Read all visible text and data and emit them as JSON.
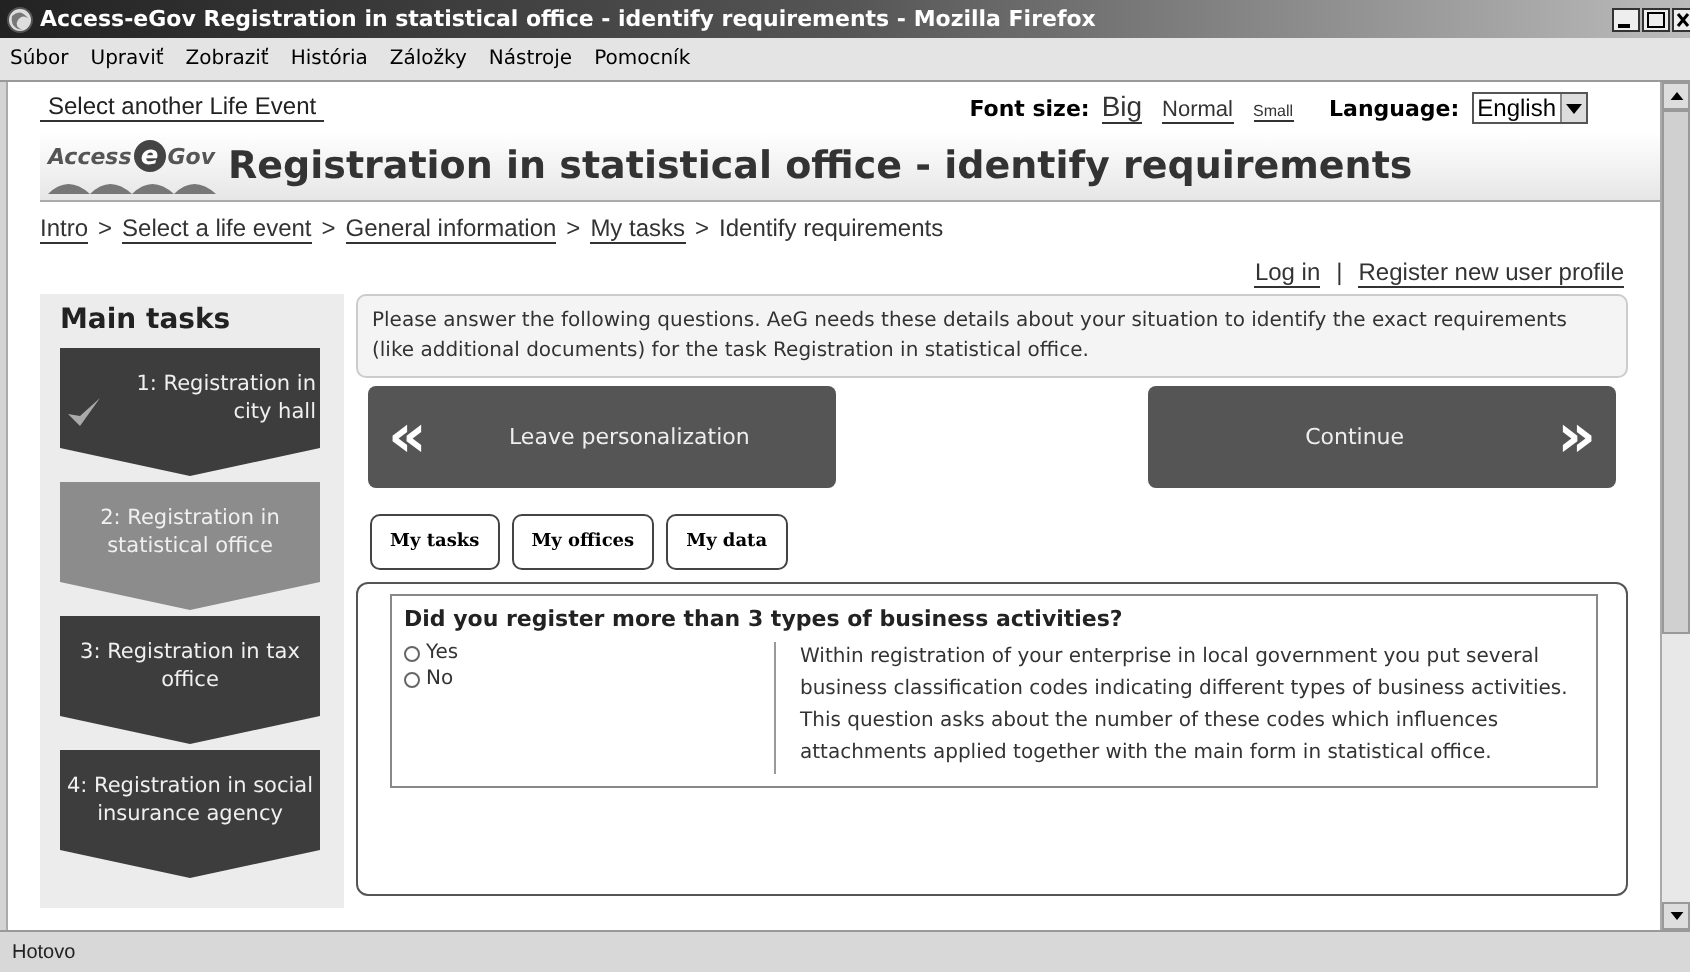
{
  "window": {
    "title": "Access-eGov Registration in statistical office - identify requirements - Mozilla Firefox"
  },
  "menu": [
    "Súbor",
    "Upraviť",
    "Zobraziť",
    "História",
    "Záložky",
    "Nástroje",
    "Pomocník"
  ],
  "top_bar": {
    "life_event_link": "Select another Life Event",
    "font_size_label": "Font size:",
    "font_sizes": [
      "Big",
      "Normal",
      "Small"
    ],
    "language_label": "Language:",
    "language": "English"
  },
  "logo": {
    "left": "Access",
    "mark": "e",
    "right": "Gov"
  },
  "page_title": "Registration in statistical office - identify requirements",
  "breadcrumb": [
    {
      "label": "Intro",
      "link": true
    },
    {
      "separator": ">",
      "label": "Select a life event",
      "link": true
    },
    {
      "separator": ">",
      "label": "General information",
      "link": true
    },
    {
      "separator": ">",
      "label": "My tasks",
      "link": true
    },
    {
      "separator": ">",
      "label": "Identify requirements",
      "link": false
    }
  ],
  "user_links": [
    {
      "label": "Log in"
    },
    {
      "separator": "|",
      "label": "Register new user profile"
    }
  ],
  "sidebar": {
    "title": "Main tasks",
    "steps": [
      {
        "label": "1: Registration in city hall",
        "done": true,
        "selected": false
      },
      {
        "label": "2: Registration in statistical office",
        "done": false,
        "selected": true
      },
      {
        "label": "3: Registration in tax office",
        "done": false,
        "selected": false
      },
      {
        "label": "4: Registration in social insurance agency",
        "done": false,
        "selected": false
      }
    ]
  },
  "intro": "Please answer the following questions. AeG needs these details about your situation to identify the exact requirements (like additional documents) for the task Registration in statistical office.",
  "nav_buttons": [
    {
      "label": "Leave personalization",
      "glyph": "«"
    },
    {
      "label": "Continue",
      "glyph": "»"
    }
  ],
  "tabs": [
    "My tasks",
    "My offices",
    "My data"
  ],
  "question": {
    "text": "Did you register more than 3 types of business activities?",
    "options": [
      {
        "label": "Yes",
        "selected": false
      },
      {
        "label": "No",
        "selected": false
      }
    ],
    "help": "Within registration of your enterprise in local government you put several business classification codes indicating different types of business activities. This question asks about the number of these codes which influences attachments applied together with the main form in statistical office."
  },
  "status_bar": "Hotovo"
}
